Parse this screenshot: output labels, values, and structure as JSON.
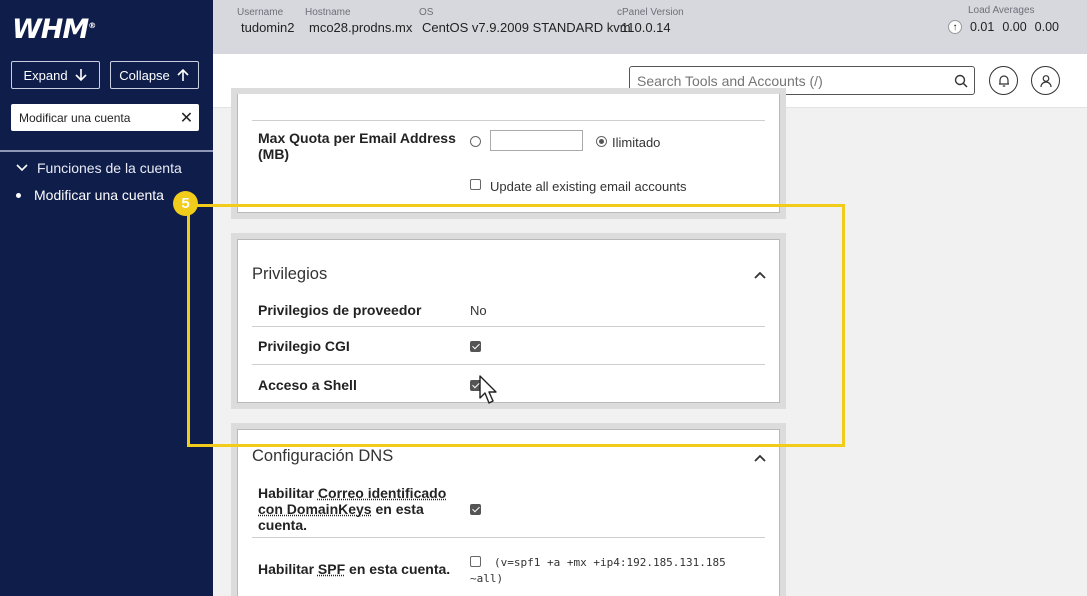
{
  "sidebar": {
    "logo": "WHM",
    "logo_mark": "®",
    "expand_label": "Expand",
    "collapse_label": "Collapse",
    "search_value": "Modificar una cuenta",
    "group_label": "Funciones de la cuenta",
    "item_label": "Modificar una cuenta"
  },
  "infobar": {
    "username_label": "Username",
    "username": "tudomin2",
    "hostname_label": "Hostname",
    "hostname": "mco28.prodns.mx",
    "os_label": "OS",
    "os": "CentOS v7.9.2009 STANDARD kvm",
    "cpanel_label": "cPanel Version",
    "cpanel": "110.0.14",
    "load_label": "Load Averages",
    "load_1": "0.01",
    "load_2": "0.00",
    "load_3": "0.00"
  },
  "header": {
    "search_placeholder": "Search Tools and Accounts (/)"
  },
  "quota_panel": {
    "max_quota_label": "Max Quota per Email Address (MB)",
    "unlimited_label": "Ilimitado",
    "update_all_label": "Update all existing email accounts"
  },
  "privileges_panel": {
    "title": "Privilegios",
    "reseller_label": "Privilegios de proveedor",
    "reseller_value": "No",
    "cgi_label": "Privilegio CGI",
    "shell_label": "Acceso a Shell"
  },
  "dns_panel": {
    "title": "Configuración DNS",
    "dkim_label_prefix": "Habilitar ",
    "dkim_label_link1": "Correo identificado con DomainKeys",
    "dkim_label_suffix": " en esta cuenta.",
    "spf_label_prefix": "Habilitar ",
    "spf_label_link": "SPF",
    "spf_label_suffix": " en esta cuenta.",
    "spf_record_1": "(v=spf1 +a +mx +ip4:192.185.131.185",
    "spf_record_2": "~all)"
  },
  "overlay": {
    "step_number": "5"
  }
}
